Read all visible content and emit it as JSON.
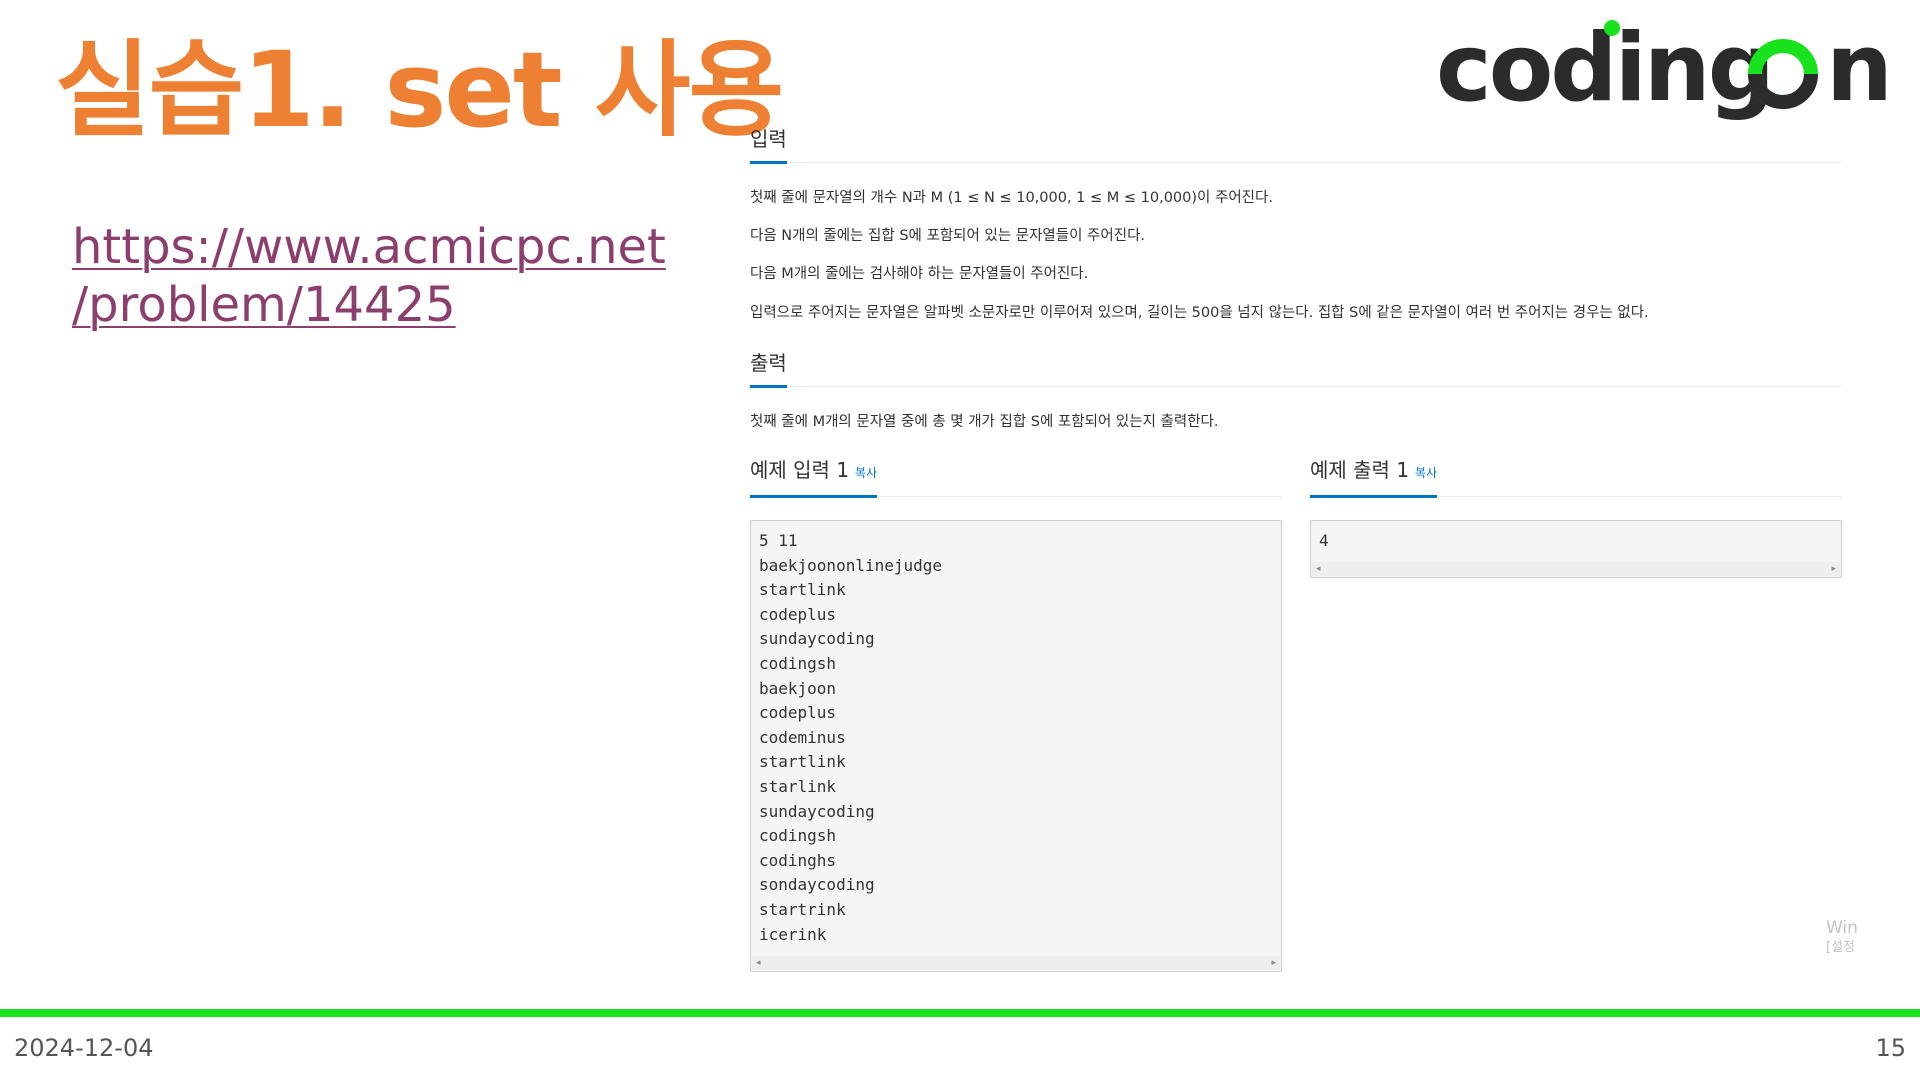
{
  "slide": {
    "title": "실습1. set 사용",
    "link_line1": "https://www.acmicpc.net",
    "link_line2": "/problem/14425",
    "date": "2024-12-04",
    "page_number": "15"
  },
  "logo": {
    "text_left": "coding",
    "text_right": "n",
    "dot_color": "#18E21B",
    "text_color": "#2B2B2B"
  },
  "problem": {
    "input_heading": "입력",
    "input_lines": [
      "첫째 줄에 문자열의 개수 N과 M (1 ≤ N ≤ 10,000, 1 ≤ M ≤ 10,000)이 주어진다.",
      "다음 N개의 줄에는 집합 S에 포함되어 있는 문자열들이 주어진다.",
      "다음 M개의 줄에는 검사해야 하는 문자열들이 주어진다.",
      "입력으로 주어지는 문자열은 알파벳 소문자로만 이루어져 있으며, 길이는 500을 넘지 않는다. 집합 S에 같은 문자열이 여러 번 주어지는 경우는 없다."
    ],
    "output_heading": "출력",
    "output_line": "첫째 줄에 M개의 문자열 중에 총 몇 개가 집합 S에 포함되어 있는지 출력한다.",
    "sample_input_heading": "예제 입력 1",
    "sample_output_heading": "예제 출력 1",
    "copy_label": "복사",
    "sample_input_lines": [
      "5 11",
      "baekjoononlinejudge",
      "startlink",
      "codeplus",
      "sundaycoding",
      "codingsh",
      "baekjoon",
      "codeplus",
      "codeminus",
      "startlink",
      "starlink",
      "sundaycoding",
      "codingsh",
      "codinghs",
      "sondaycoding",
      "startrink",
      "icerink"
    ],
    "sample_output_lines": [
      "4"
    ]
  },
  "watermark": {
    "line1": "Win",
    "line2": "[설정"
  },
  "colors": {
    "title": "#EE8033",
    "link": "#8C3F6E",
    "accent_blue": "#0076C0",
    "footer_bar": "#18E21B"
  }
}
